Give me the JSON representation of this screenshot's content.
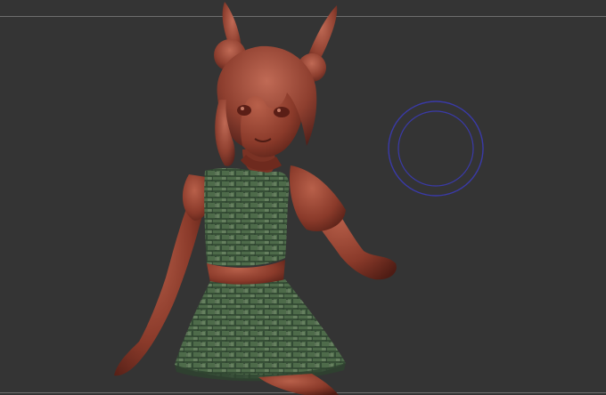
{
  "viewport": {
    "background": "#343434",
    "guide_color": "#6e6e6e"
  },
  "model": {
    "skin_color": "#8a3a2a",
    "skin_shadow": "#4e1c14",
    "skin_highlight": "#b8604a",
    "dress_color": "#4e6b4a",
    "dress_shadow": "#2e4430",
    "dress_highlight": "#7a9270"
  },
  "brush_cursor": {
    "ring_color": "#3a3aa8",
    "icon": "brush-circle-icon"
  }
}
